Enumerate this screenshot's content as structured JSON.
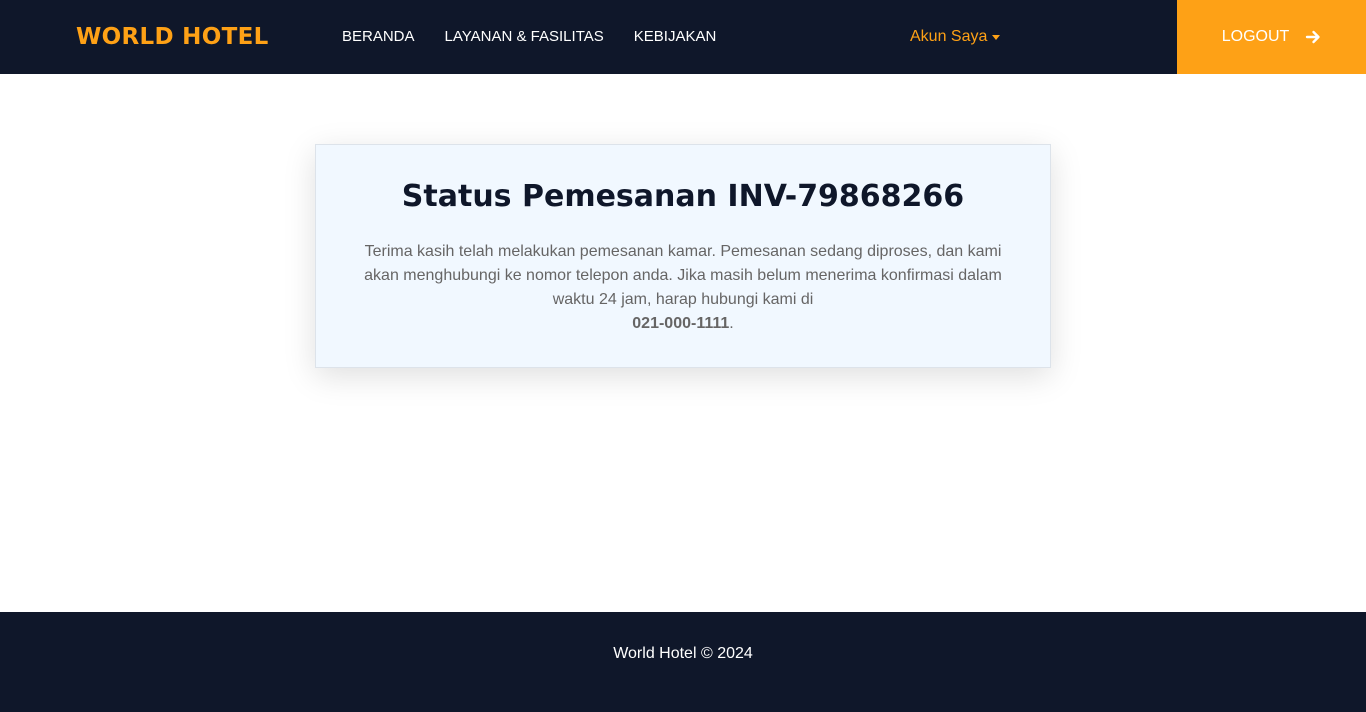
{
  "navbar": {
    "brand": "WORLD HOTEL",
    "links": [
      "BERANDA",
      "LAYANAN & FASILITAS",
      "KEBIJAKAN"
    ],
    "account_label": "Akun Saya",
    "logout_label": "LOGOUT",
    "logout_icon": "arrow-right-icon"
  },
  "card": {
    "title": "Status Pemesanan INV-79868266",
    "message": "Terima kasih telah melakukan pemesanan kamar. Pemesanan sedang diproses, dan kami akan menghubungi ke nomor telepon anda. Jika masih belum menerima konfirmasi dalam waktu 24 jam, harap hubungi kami di",
    "phone": "021-000-1111",
    "suffix": "."
  },
  "footer": {
    "text": "World Hotel © 2024"
  },
  "colors": {
    "navy": "#0f172a",
    "accent": "#fea116",
    "card_bg": "#f1f8ff",
    "text_muted": "#666565"
  }
}
